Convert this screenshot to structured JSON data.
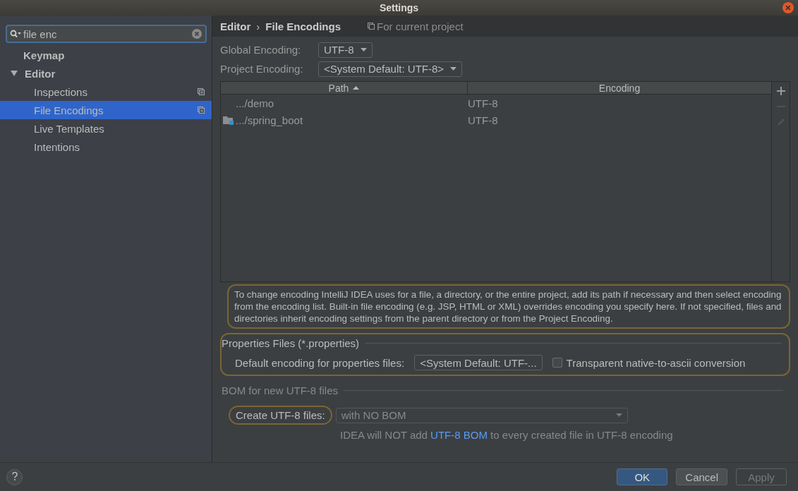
{
  "window": {
    "title": "Settings"
  },
  "search": {
    "value": "file enc"
  },
  "sidebar": {
    "items": [
      {
        "label": "Keymap",
        "kind": "group",
        "selected": false
      },
      {
        "label": "Editor",
        "kind": "group",
        "selected": false,
        "expanded": true,
        "children": [
          {
            "label": "Inspections",
            "kind": "page",
            "selected": false,
            "project_level": true
          },
          {
            "label": "File Encodings",
            "kind": "page",
            "selected": true,
            "project_level": true
          },
          {
            "label": "Live Templates",
            "kind": "page",
            "selected": false,
            "project_level": false
          },
          {
            "label": "Intentions",
            "kind": "page",
            "selected": false,
            "project_level": false
          }
        ]
      }
    ]
  },
  "header": {
    "breadcrumb": [
      "Editor",
      "File Encodings"
    ],
    "separator": "›",
    "scope": "For current project"
  },
  "global_encoding": {
    "label": "Global Encoding:",
    "value": "UTF-8"
  },
  "project_encoding": {
    "label": "Project Encoding:",
    "value": "<System Default: UTF-8>"
  },
  "table": {
    "columns": [
      {
        "label": "Path",
        "sorted": true
      },
      {
        "label": "Encoding",
        "sorted": false
      }
    ],
    "rows": [
      {
        "kind": "plain",
        "path": ".../demo",
        "encoding": "UTF-8"
      },
      {
        "kind": "module",
        "path": ".../spring_boot",
        "encoding": "UTF-8"
      }
    ],
    "toolbar": [
      {
        "kind": "add",
        "disabled": false
      },
      {
        "kind": "remove",
        "disabled": true
      },
      {
        "kind": "edit",
        "disabled": true
      }
    ]
  },
  "hint": {
    "text": "To change encoding IntelliJ IDEA uses for a file, a directory, or the entire project, add its path if necessary and then select encoding from the encoding list. Built-in file encoding (e.g. JSP, HTML or XML) overrides encoding you specify here. If not specified, files and directories inherit encoding settings from the parent directory or from the Project Encoding.",
    "highlighted": true
  },
  "properties": {
    "title": "Properties Files (*.properties)",
    "highlighted": true,
    "label": "Default encoding for properties files:",
    "value": "<System Default: UTF-...",
    "checkbox": {
      "label": "Transparent native-to-ascii conversion",
      "checked": false
    }
  },
  "bom": {
    "title": "BOM for new UTF-8 files",
    "label": "Create UTF-8 files:",
    "label_highlighted": true,
    "value": "with NO BOM",
    "disabled": true,
    "note_before": "IDEA will NOT add",
    "note_link": "UTF-8 BOM",
    "note_after": "to every created file in UTF-8 encoding"
  },
  "buttons": [
    {
      "label": "OK",
      "kind": "default",
      "disabled": false
    },
    {
      "label": "Cancel",
      "kind": "normal",
      "disabled": false
    },
    {
      "label": "Apply",
      "kind": "normal",
      "disabled": true
    }
  ]
}
